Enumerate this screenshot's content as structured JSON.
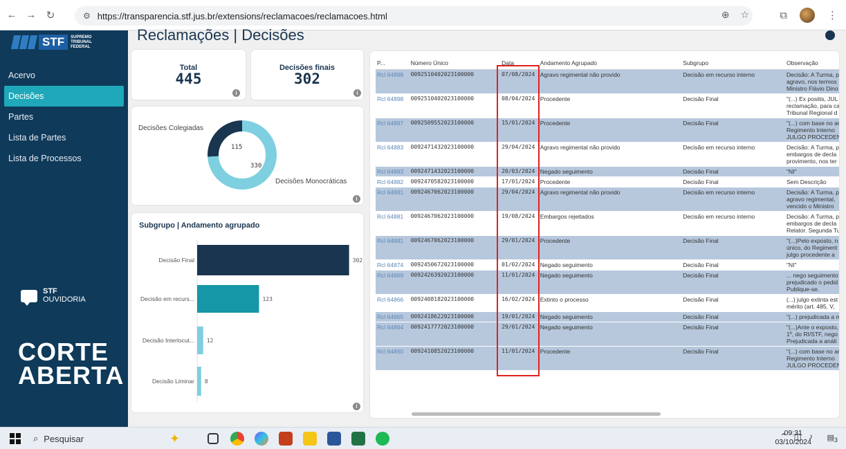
{
  "browser": {
    "url": "https://transparencia.stf.jus.br/extensions/reclamacoes/reclamacoes.html"
  },
  "app": {
    "page_title": "Reclamações | Decisões",
    "logo": {
      "brand": "STF",
      "subtitle": "SUPREMO TRIBUNAL FEDERAL"
    },
    "nav": [
      "Acervo",
      "Decisões",
      "Partes",
      "Lista de Partes",
      "Lista de Processos"
    ],
    "active_nav": "Decisões",
    "ouvidoria": {
      "line1": "STF",
      "line2": "OUVIDORIA"
    },
    "corte": {
      "line1": "CORTE",
      "line2": "ABERTA"
    }
  },
  "kpis": {
    "total": {
      "label": "Total",
      "value": "445"
    },
    "finais": {
      "label": "Decisões finais",
      "value": "302"
    }
  },
  "donut": {
    "label_colegiadas": "Decisões Colegiadas",
    "label_monocraticas": "Decisões Monocráticas",
    "value_colegiadas": 115,
    "value_monocraticas": 330,
    "color_colegiadas": "#1a3550",
    "color_monocraticas": "#7ecfe0"
  },
  "chart_data": {
    "type": "bar",
    "title": "Subgrupo | Andamento agrupado",
    "categories": [
      "Decisão Final",
      "Decisão em recurs...",
      "Decisão Interlocut...",
      "Decisão Liminar"
    ],
    "values": [
      302,
      123,
      12,
      8
    ],
    "colors": [
      "#1a3550",
      "#1597a7",
      "#7ecfe0",
      "#7ecfe0"
    ],
    "xlim": [
      0,
      330
    ]
  },
  "table": {
    "headers": [
      "P...",
      "Número Único",
      "Data",
      "Andamento Agrupado",
      "Subgrupo",
      "Observação"
    ],
    "rows": [
      {
        "p": "Rcl 64898",
        "num": "0092510402023100000",
        "data": "07/08/2024",
        "and": "Agravo regimental não provido",
        "sub": "Decisão em recurso interno",
        "obs": "Decisão: A Turma, p agravo, nos termos Ministro Flávio Dino",
        "sel": true
      },
      {
        "p": "Rcl 64898",
        "num": "0092510402023100000",
        "data": "08/04/2024",
        "and": "Procedente",
        "sub": "Decisão Final",
        "obs": "\"(...) Ex positis, JUL reclamação, para ca Tribunal Regional d",
        "sel": false
      },
      {
        "p": "Rcl 64897",
        "num": "0092509552023100000",
        "data": "15/01/2024",
        "and": "Procedente",
        "sub": "Decisão Final",
        "obs": "\"(...) com base no ar Regimento Interno JULGO PROCEDEN",
        "sel": true
      },
      {
        "p": "Rcl 64883",
        "num": "0092471432023100000",
        "data": "29/04/2024",
        "and": "Agravo regimental não provido",
        "sub": "Decisão em recurso interno",
        "obs": "Decisão: A Turma, p embargos de decla provimento, nos ter",
        "sel": false
      },
      {
        "p": "Rcl 64883",
        "num": "0092471432023100000",
        "data": "20/03/2024",
        "and": "Negado seguimento",
        "sub": "Decisão Final",
        "obs": "\"NI\"",
        "sel": true
      },
      {
        "p": "Rcl 64882",
        "num": "0092470582023100000",
        "data": "17/01/2024",
        "and": "Procedente",
        "sub": "Decisão Final",
        "obs": "Sem Descrição",
        "sel": false
      },
      {
        "p": "Rcl 64881",
        "num": "0092467062023100000",
        "data": "29/04/2024",
        "and": "Agravo regimental não provido",
        "sub": "Decisão em recurso interno",
        "obs": "Decisão: A Turma, p agravo regimental, vencido o Ministro",
        "sel": true
      },
      {
        "p": "Rcl 64881",
        "num": "0092467062023100000",
        "data": "19/08/2024",
        "and": "Embargos rejeitados",
        "sub": "Decisão em recurso interno",
        "obs": "Decisão: A Turma, p embargos de decla Relator. Segunda Tu",
        "sel": false
      },
      {
        "p": "Rcl 64881",
        "num": "0092467062023100000",
        "data": "29/01/2024",
        "and": "Procedente",
        "sub": "Decisão Final",
        "obs": "\"(...)Pelo exposto, n único, do Regiment julgo procedente a",
        "sel": true
      },
      {
        "p": "Rcl 64874",
        "num": "0092450672023100000",
        "data": "01/02/2024",
        "and": "Negado seguimento",
        "sub": "Decisão Final",
        "obs": "\"NI\"",
        "sel": false
      },
      {
        "p": "Rcl 64869",
        "num": "0092426392023100000",
        "data": "11/01/2024",
        "and": "Negado seguimento",
        "sub": "Decisão Final",
        "obs": "... nego seguimento prejudicado o pedid Publique-se.",
        "sel": true
      },
      {
        "p": "Rcl 64866",
        "num": "0092408182023100000",
        "data": "16/02/2024",
        "and": "Extinto o processo",
        "sub": "Decisão Final",
        "obs": "(...) julgo extinta est mérito (art. 485, V,",
        "sel": false
      },
      {
        "p": "Rcl 64865",
        "num": "0092418622023100000",
        "data": "19/01/2024",
        "and": "Negado seguimento",
        "sub": "Decisão Final",
        "obs": "\"(...) prejudicada a m",
        "sel": true
      },
      {
        "p": "Rcl 64864",
        "num": "0092417772023100000",
        "data": "29/01/2024",
        "and": "Negado seguimento",
        "sub": "Decisão Final",
        "obs": "\"(...)Ante o exposto, 1º, do RI/STF, nego Prejudicada a análi",
        "sel": true
      },
      {
        "p": "Rcl 64860",
        "num": "0092410852023100000",
        "data": "11/01/2024",
        "and": "Procedente",
        "sub": "Decisão Final",
        "obs": "\"(...) com base no ar Regimento Interno JULGO PROCEDEN",
        "sel": true
      }
    ]
  },
  "taskbar": {
    "search_placeholder": "Pesquisar",
    "time": "09:31",
    "date": "03/10/2024",
    "notifications": "3"
  }
}
